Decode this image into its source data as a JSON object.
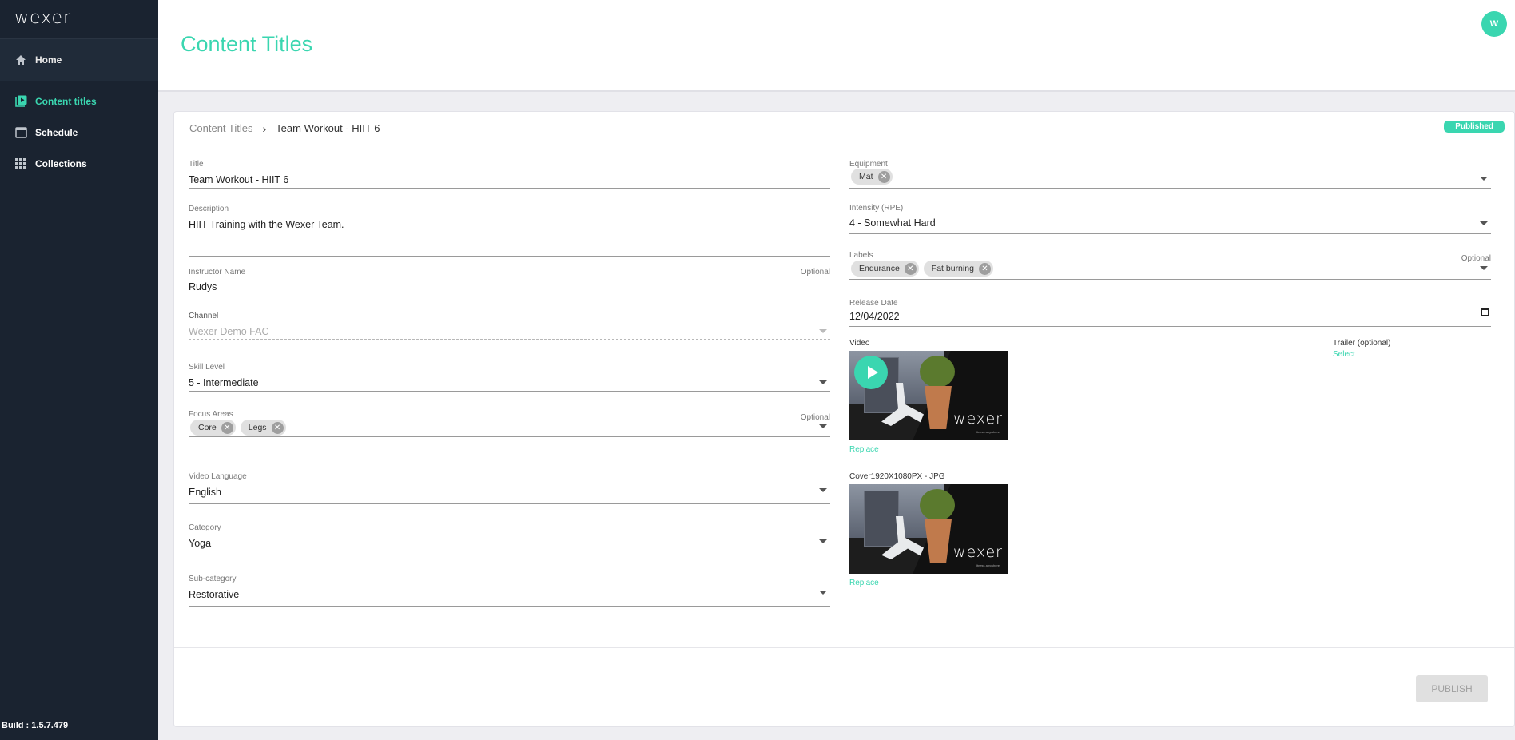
{
  "sidebar": {
    "logo": "wexer",
    "home": "Home",
    "items": [
      {
        "label": "Content titles"
      },
      {
        "label": "Schedule"
      },
      {
        "label": "Collections"
      }
    ],
    "build": "Build : 1.5.7.479"
  },
  "header": {
    "title": "Content Titles",
    "avatar_initial": "W"
  },
  "breadcrumb": {
    "parent": "Content Titles",
    "separator": "›",
    "current": "Team Workout - HIIT 6"
  },
  "status": "Published",
  "form": {
    "title": {
      "label": "Title",
      "value": "Team Workout - HIIT 6"
    },
    "description": {
      "label": "Description",
      "value": "HIIT Training with the Wexer Team."
    },
    "instructor": {
      "label": "Instructor Name",
      "optional": "Optional",
      "value": "Rudys"
    },
    "channel": {
      "label": "Channel",
      "value": "Wexer Demo FAC"
    },
    "skill_level": {
      "label": "Skill Level",
      "value": "5 - Intermediate"
    },
    "focus_areas": {
      "label": "Focus Areas",
      "optional": "Optional",
      "chips": [
        "Core",
        "Legs"
      ]
    },
    "video_language": {
      "label": "Video Language",
      "value": "English"
    },
    "category": {
      "label": "Category",
      "value": "Yoga"
    },
    "sub_category": {
      "label": "Sub-category",
      "value": "Restorative"
    },
    "equipment": {
      "label": "Equipment",
      "chips": [
        "Mat"
      ]
    },
    "intensity": {
      "label": "Intensity (RPE)",
      "value": "4 - Somewhat Hard"
    },
    "labels": {
      "label": "Labels",
      "optional": "Optional",
      "chips": [
        "Endurance",
        "Fat burning"
      ]
    },
    "release_date": {
      "label": "Release Date",
      "value": "12/04/2022"
    }
  },
  "media": {
    "video_label": "Video",
    "trailer_label": "Trailer (optional)",
    "trailer_select": "Select",
    "replace": "Replace",
    "cover_label": "Cover1920X1080PX - JPG",
    "thumb_brand": "wexer",
    "thumb_tag": "fitness anywhere"
  },
  "publish_button": "PUBLISH",
  "colors": {
    "accent": "#3ad6b0",
    "sidebar": "#1a2330"
  }
}
